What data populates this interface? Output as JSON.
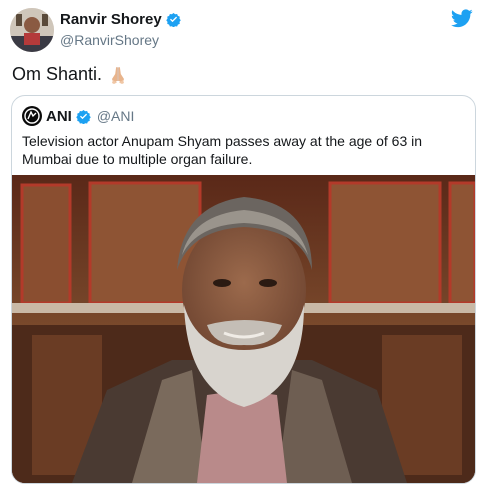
{
  "author": {
    "display_name": "Ranvir Shorey",
    "handle": "@RanvirShorey"
  },
  "tweet": {
    "text": "Om Shanti."
  },
  "quoted_tweet": {
    "display_name": "ANI",
    "handle": "@ANI",
    "text": "Television actor Anupam Shyam passes away at the age of 63 in Mumbai due to multiple organ failure."
  },
  "icons": {
    "verified": "verified-badge-icon",
    "platform": "twitter-bird-icon",
    "emoji": "folded-hands-emoji"
  },
  "colors": {
    "brand_blue": "#1da1f2",
    "text": "#14171a",
    "muted": "#657786",
    "border": "#ccd6dd"
  }
}
